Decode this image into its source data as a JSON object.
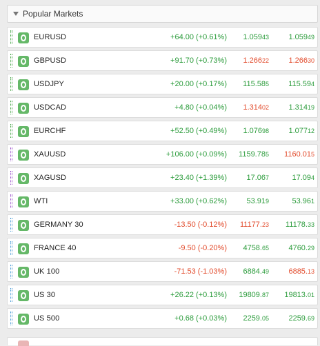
{
  "header": {
    "title": "Popular Markets"
  },
  "colors": {
    "positive": "#2c9c3c",
    "negative": "#e24b2c",
    "badge": "#65b868"
  },
  "markets": [
    {
      "symbol": "EURUSD",
      "stripe": "green",
      "change": "+64.00 (+0.61%)",
      "change_dir": "pos",
      "bid_main": "1.059",
      "bid_small": "43",
      "bid_dir": "pos",
      "ask_main": "1.059",
      "ask_small": "49",
      "ask_dir": "pos"
    },
    {
      "symbol": "GBPUSD",
      "stripe": "green",
      "change": "+91.70 (+0.73%)",
      "change_dir": "pos",
      "bid_main": "1.266",
      "bid_small": "22",
      "bid_dir": "neg",
      "ask_main": "1.266",
      "ask_small": "30",
      "ask_dir": "neg"
    },
    {
      "symbol": "USDJPY",
      "stripe": "green",
      "change": "+20.00 (+0.17%)",
      "change_dir": "pos",
      "bid_main": "115.58",
      "bid_small": "5",
      "bid_dir": "pos",
      "ask_main": "115.59",
      "ask_small": "4",
      "ask_dir": "pos"
    },
    {
      "symbol": "USDCAD",
      "stripe": "green",
      "change": "+4.80 (+0.04%)",
      "change_dir": "pos",
      "bid_main": "1.314",
      "bid_small": "02",
      "bid_dir": "neg",
      "ask_main": "1.314",
      "ask_small": "19",
      "ask_dir": "pos"
    },
    {
      "symbol": "EURCHF",
      "stripe": "green",
      "change": "+52.50 (+0.49%)",
      "change_dir": "pos",
      "bid_main": "1.076",
      "bid_small": "98",
      "bid_dir": "pos",
      "ask_main": "1.077",
      "ask_small": "12",
      "ask_dir": "pos"
    },
    {
      "symbol": "XAUUSD",
      "stripe": "purple",
      "change": "+106.00 (+0.09%)",
      "change_dir": "pos",
      "bid_main": "1159.78",
      "bid_small": "5",
      "bid_dir": "pos",
      "ask_main": "1160.01",
      "ask_small": "5",
      "ask_dir": "neg"
    },
    {
      "symbol": "XAGUSD",
      "stripe": "purple",
      "change": "+23.40 (+1.39%)",
      "change_dir": "pos",
      "bid_main": "17.06",
      "bid_small": "7",
      "bid_dir": "pos",
      "ask_main": "17.09",
      "ask_small": "4",
      "ask_dir": "pos"
    },
    {
      "symbol": "WTI",
      "stripe": "purple",
      "change": "+33.00 (+0.62%)",
      "change_dir": "pos",
      "bid_main": "53.91",
      "bid_small": "9",
      "bid_dir": "pos",
      "ask_main": "53.96",
      "ask_small": "1",
      "ask_dir": "pos"
    },
    {
      "symbol": "GERMANY 30",
      "stripe": "blue",
      "change": "-13.50 (-0.12%)",
      "change_dir": "neg",
      "bid_main": "11177.",
      "bid_small": "23",
      "bid_dir": "neg",
      "ask_main": "11178.",
      "ask_small": "33",
      "ask_dir": "pos"
    },
    {
      "symbol": "FRANCE 40",
      "stripe": "blue",
      "change": "-9.50 (-0.20%)",
      "change_dir": "neg",
      "bid_main": "4758.",
      "bid_small": "65",
      "bid_dir": "pos",
      "ask_main": "4760.",
      "ask_small": "29",
      "ask_dir": "pos"
    },
    {
      "symbol": "UK 100",
      "stripe": "blue",
      "change": "-71.53 (-1.03%)",
      "change_dir": "neg",
      "bid_main": "6884.",
      "bid_small": "49",
      "bid_dir": "pos",
      "ask_main": "6885.",
      "ask_small": "13",
      "ask_dir": "neg"
    },
    {
      "symbol": "US 30",
      "stripe": "blue",
      "change": "+26.22 (+0.13%)",
      "change_dir": "pos",
      "bid_main": "19809.",
      "bid_small": "87",
      "bid_dir": "pos",
      "ask_main": "19813.",
      "ask_small": "01",
      "ask_dir": "pos"
    },
    {
      "symbol": "US 500",
      "stripe": "blue",
      "change": "+0.68 (+0.03%)",
      "change_dir": "pos",
      "bid_main": "2259.",
      "bid_small": "05",
      "bid_dir": "pos",
      "ask_main": "2259.",
      "ask_small": "69",
      "ask_dir": "pos"
    }
  ]
}
